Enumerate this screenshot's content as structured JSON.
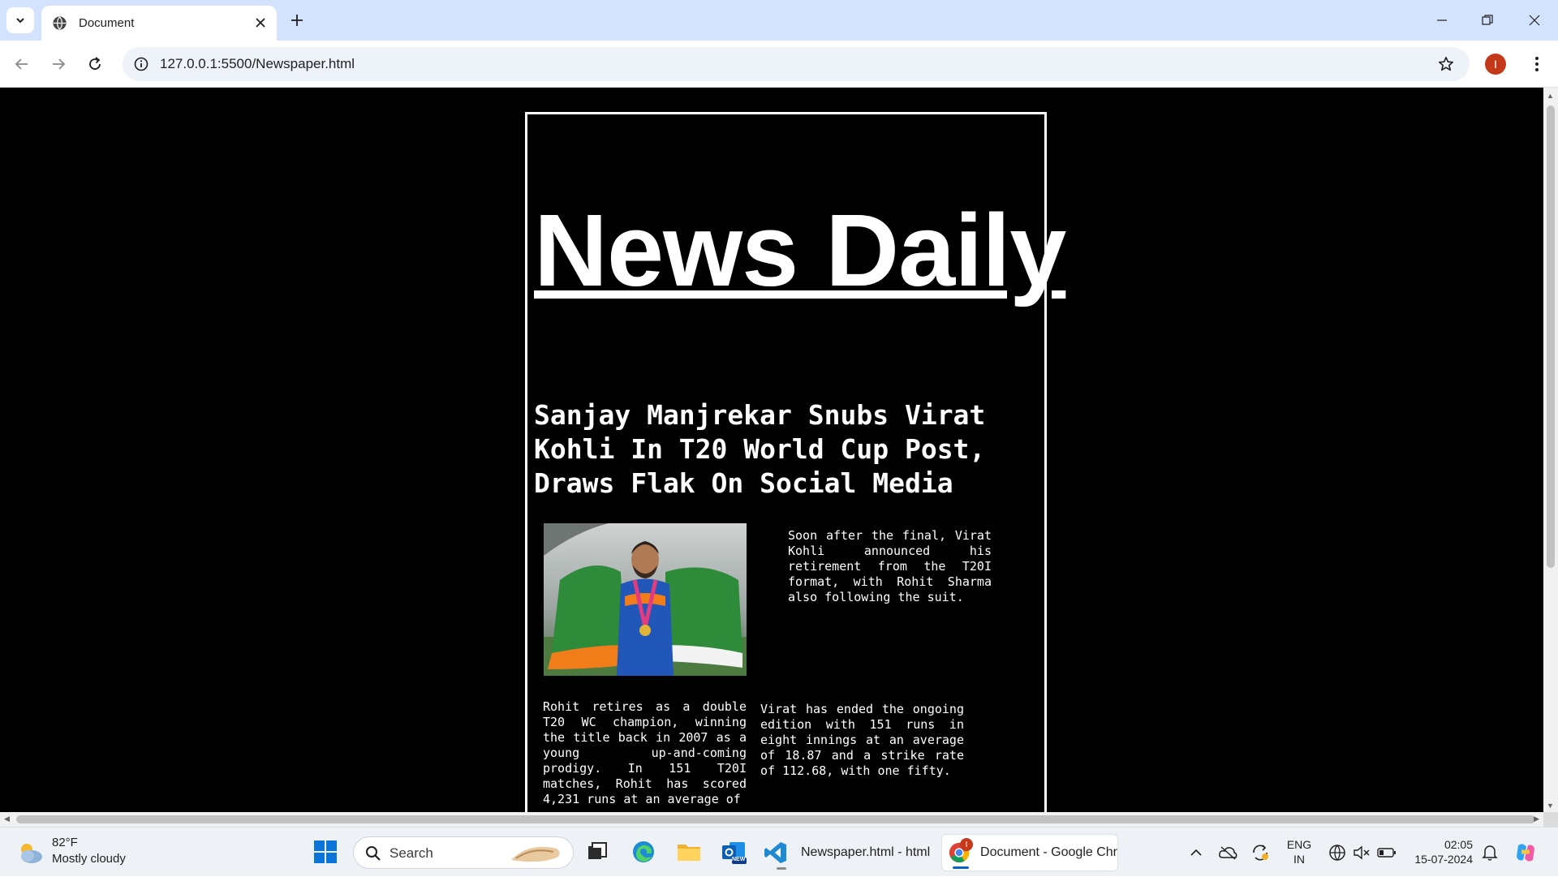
{
  "browser": {
    "tab_title": "Document",
    "url": "127.0.0.1:5500/Newspaper.html",
    "profile_initial": "I"
  },
  "page": {
    "masthead": "News Daily",
    "headline": "Sanjay Manjrekar Snubs Virat Kohli In T20 World Cup Post, Draws Flak On Social Media",
    "paragraph_1": "Soon after the final, Virat Kohli announced his retirement from the T20I format, with Rohit Sharma also following the suit.",
    "paragraph_2": "Rohit retires as a double T20 WC champion, winning the title back in 2007 as a young up-and-coming prodigy. In 151 T20I matches, Rohit has scored 4,231 runs at an average of",
    "paragraph_3": "Virat has ended the ongoing edition with 151 runs in eight innings at an average of 18.87 and a strike rate of 112.68, with one fifty."
  },
  "taskbar": {
    "weather_temp": "82°F",
    "weather_condition": "Mostly cloudy",
    "search_label": "Search",
    "vscode_label": "Newspaper.html - html",
    "chrome_label": "Document - Google Chr",
    "chrome_badge": "I",
    "outlook_badge": "NEW",
    "language_top": "ENG",
    "language_bottom": "IN",
    "time": "02:05",
    "date": "15-07-2024"
  },
  "colors": {
    "tabbar_bg": "#d3e3fd",
    "page_bg": "#000000",
    "text": "#ffffff",
    "profile_bg": "#c5391b"
  },
  "icons": [
    "tab-search-icon",
    "globe-icon",
    "close-icon",
    "plus-icon",
    "minimize-icon",
    "restore-icon",
    "window-close-icon",
    "back-icon",
    "forward-icon",
    "reload-icon",
    "site-info-icon",
    "star-icon",
    "kebab-menu-icon",
    "weather-icon",
    "windows-start-icon",
    "search-icon",
    "task-view-icon",
    "edge-icon",
    "file-explorer-icon",
    "outlook-icon",
    "vscode-icon",
    "chrome-icon",
    "chevron-up-icon",
    "onedrive-icon",
    "sync-icon",
    "network-icon",
    "mute-icon",
    "battery-icon",
    "notification-icon",
    "copilot-icon"
  ]
}
